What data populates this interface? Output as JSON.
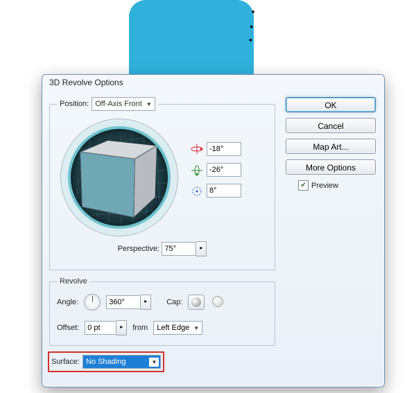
{
  "dialog": {
    "title": "3D Revolve Options"
  },
  "position_group": {
    "legend": "Position:",
    "preset": "Off-Axis Front",
    "rot_x": "-18°",
    "rot_y": "-26°",
    "rot_z": "8°",
    "perspective_label": "Perspective:",
    "perspective": "75°"
  },
  "revolve_group": {
    "legend": "Revolve",
    "angle_label": "Angle:",
    "angle": "360°",
    "cap_label": "Cap:",
    "offset_label": "Offset:",
    "offset": "0 pt",
    "from_label": "from",
    "from_value": "Left Edge"
  },
  "surface": {
    "label": "Surface:",
    "value": "No Shading"
  },
  "buttons": {
    "ok": "OK",
    "cancel": "Cancel",
    "map_art": "Map Art...",
    "more_options": "More Options"
  },
  "preview": {
    "label": "Preview",
    "checked": true
  }
}
